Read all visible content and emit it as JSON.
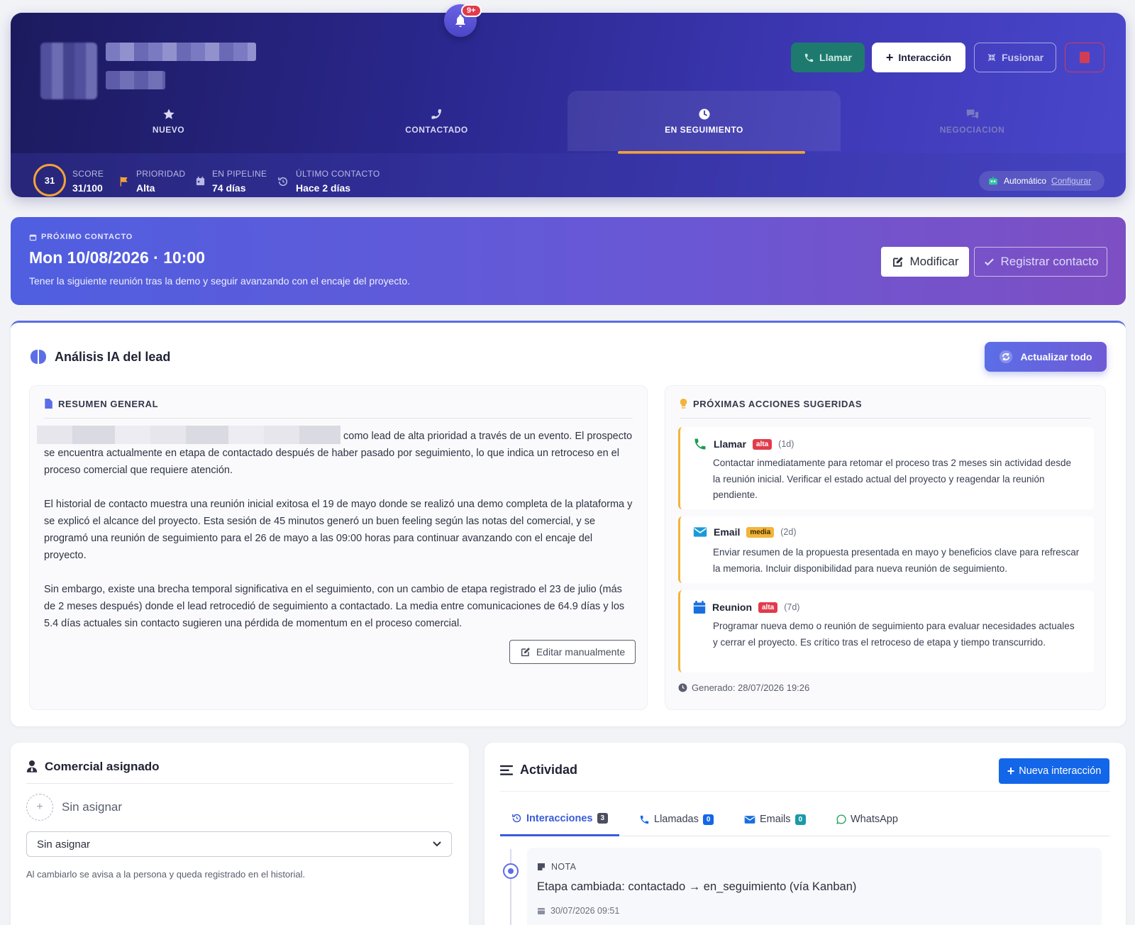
{
  "notifications": {
    "badge": "9+"
  },
  "header_actions": {
    "call": "Llamar",
    "interaction": "Interacción",
    "merge": "Fusionar"
  },
  "stages": [
    {
      "label": "NUEVO",
      "icon": "star-icon"
    },
    {
      "label": "CONTACTADO",
      "icon": "phone-icon"
    },
    {
      "label": "EN SEGUIMIENTO",
      "icon": "clock-icon",
      "active": true
    },
    {
      "label": "NEGOCIACION",
      "icon": "chat-icon"
    }
  ],
  "stats": {
    "score_value": "31",
    "score": {
      "label": "SCORE",
      "value": "31/100"
    },
    "priority": {
      "label": "PRIORIDAD",
      "value": "Alta"
    },
    "pipeline": {
      "label": "EN PIPELINE",
      "value": "74 días"
    },
    "last_contact": {
      "label": "ÚLTIMO CONTACTO",
      "value": "Hace 2 días"
    },
    "auto": {
      "label": "Automático",
      "link": "Configurar"
    }
  },
  "next_contact": {
    "tag": "PRÓXIMO CONTACTO",
    "when": "Mon 10/08/2026 · 10:00",
    "description": "Tener la siguiente reunión tras la demo y seguir avanzando con el encaje del proyecto.",
    "modify": "Modificar",
    "register": "Registrar contacto"
  },
  "ai_analysis": {
    "title": "Análisis IA del lead",
    "refresh": "Actualizar todo",
    "summary_title": "RESUMEN GENERAL",
    "summary_p1_tail": "como lead de alta prioridad a través de un evento. El prospecto se encuentra actualmente en etapa de contactado después de haber pasado por seguimiento, lo que indica un retroceso en el proceso comercial que requiere atención.",
    "summary_p2": "El historial de contacto muestra una reunión inicial exitosa el 19 de mayo donde se realizó una demo completa de la plataforma y se explicó el alcance del proyecto. Esta sesión de 45 minutos generó un buen feeling según las notas del comercial, y se programó una reunión de seguimiento para el 26 de mayo a las 09:00 horas para continuar avanzando con el encaje del proyecto.",
    "summary_p3": "Sin embargo, existe una brecha temporal significativa en el seguimiento, con un cambio de etapa registrado el 23 de julio (más de 2 meses después) donde el lead retrocedió de seguimiento a contactado. La media entre comunicaciones de 64.9 días y los 5.4 días actuales sin contacto sugieren una pérdida de momentum en el proceso comercial.",
    "edit": "Editar manualmente",
    "actions_title": "PRÓXIMAS ACCIONES SUGERIDAS",
    "actions": [
      {
        "type": "Llamar",
        "priority": "alta",
        "days": "(1d)",
        "icon": "phone-icon",
        "text": "Contactar inmediatamente para retomar el proceso tras 2 meses sin actividad desde la reunión inicial. Verificar el estado actual del proyecto y reagendar la reunión pendiente."
      },
      {
        "type": "Email",
        "priority": "media",
        "days": "(2d)",
        "icon": "envelope-icon",
        "text": "Enviar resumen de la propuesta presentada en mayo y beneficios clave para refrescar la memoria. Incluir disponibilidad para nueva reunión de seguimiento."
      },
      {
        "type": "Reunion",
        "priority": "alta",
        "days": "(7d)",
        "icon": "calendar-icon",
        "text": "Programar nueva demo o reunión de seguimiento para evaluar necesidades actuales y cerrar el proyecto. Es crítico tras el retroceso de etapa y tiempo transcurrido."
      }
    ],
    "generated": "Generado: 28/07/2026 19:26"
  },
  "assigned": {
    "title": "Comercial asignado",
    "current": "Sin asignar",
    "select_value": "Sin asignar",
    "hint": "Al cambiarlo se avisa a la persona y queda registrado en el historial."
  },
  "activity": {
    "title": "Actividad",
    "new": "Nueva interacción",
    "tabs": [
      {
        "label": "Interacciones",
        "count": "3"
      },
      {
        "label": "Llamadas",
        "count": "0"
      },
      {
        "label": "Emails",
        "count": "0"
      },
      {
        "label": "WhatsApp"
      }
    ],
    "note": {
      "type": "NOTA",
      "body": "Etapa cambiada: contactado → en_seguimiento (vía Kanban)",
      "date": "30/07/2026 09:51"
    }
  },
  "colors": {
    "accent": "#5b6ee6",
    "warning": "#f2a23a",
    "danger": "#e23b4b",
    "primary": "#1366e8"
  }
}
